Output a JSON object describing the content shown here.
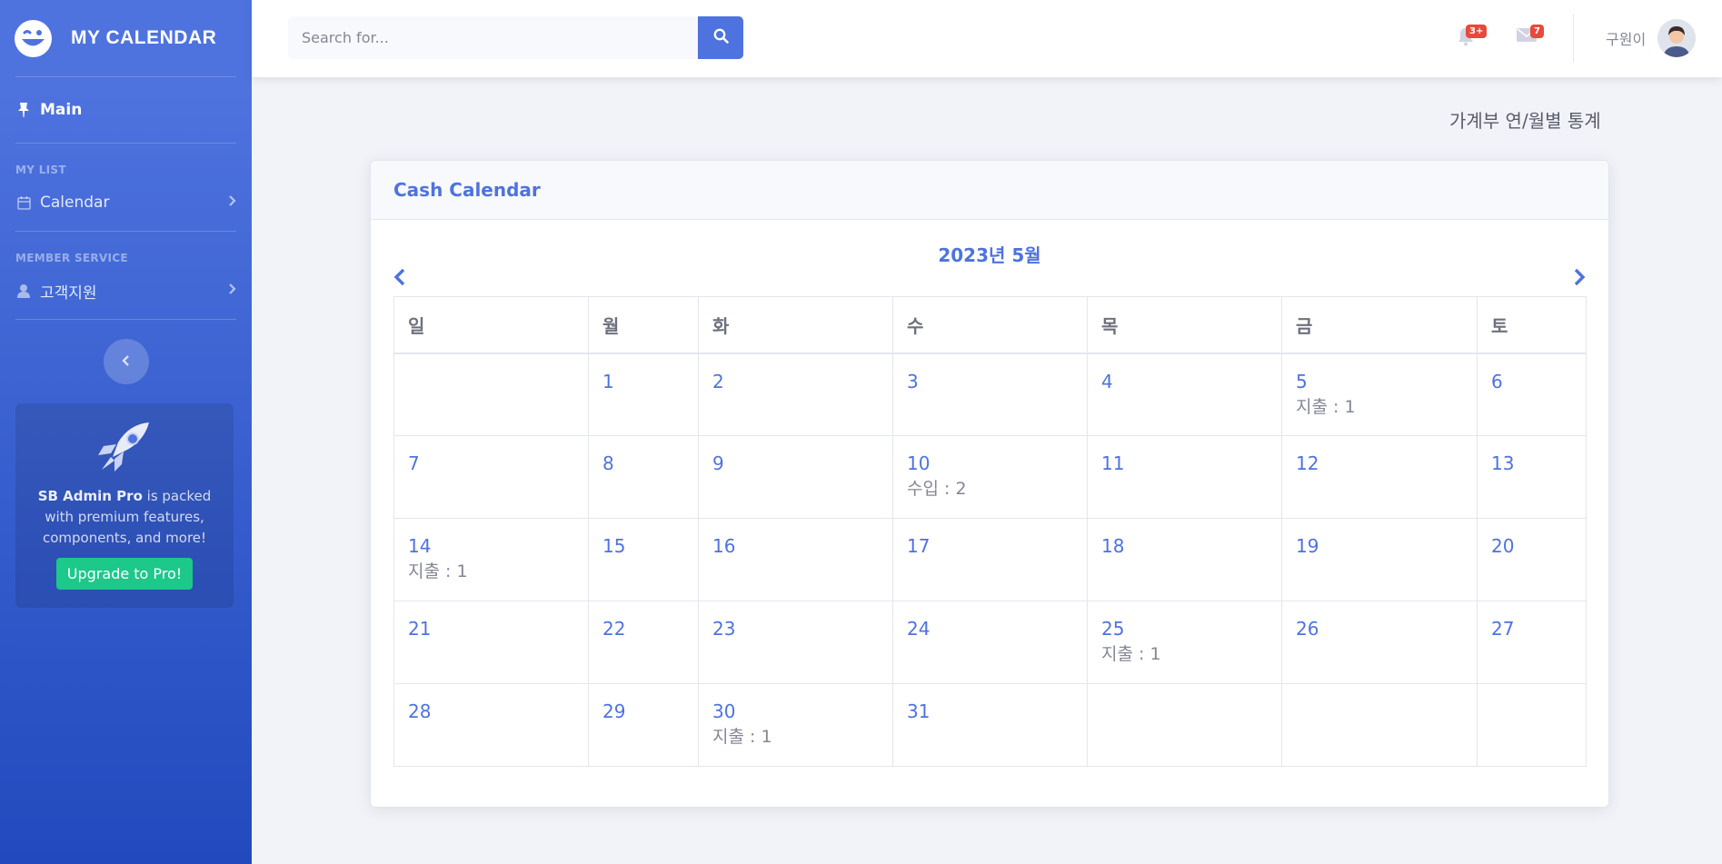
{
  "sidebar": {
    "brand": "MY CALENDAR",
    "main": "Main",
    "heading_list": "MY LIST",
    "calendar": "Calendar",
    "heading_member": "MEMBER SERVICE",
    "support": "고객지원",
    "promo": {
      "brand": "SB Admin Pro",
      "text": " is packed with premium features, components, and more!",
      "button": "Upgrade to Pro!"
    }
  },
  "topbar": {
    "search_placeholder": "Search for...",
    "alerts_badge": "3+",
    "messages_badge": "7",
    "username": "구원이"
  },
  "content": {
    "stats_link": "가계부 연/월별 통계",
    "card_title": "Cash Calendar",
    "month_title": "2023년 5월",
    "weekdays": [
      "일",
      "월",
      "화",
      "수",
      "목",
      "금",
      "토"
    ],
    "weeks": [
      [
        {
          "day": "",
          "note": ""
        },
        {
          "day": "1",
          "note": ""
        },
        {
          "day": "2",
          "note": ""
        },
        {
          "day": "3",
          "note": ""
        },
        {
          "day": "4",
          "note": ""
        },
        {
          "day": "5",
          "note": "지출 : 1"
        },
        {
          "day": "6",
          "note": ""
        }
      ],
      [
        {
          "day": "7",
          "note": ""
        },
        {
          "day": "8",
          "note": ""
        },
        {
          "day": "9",
          "note": ""
        },
        {
          "day": "10",
          "note": "수입 : 2"
        },
        {
          "day": "11",
          "note": ""
        },
        {
          "day": "12",
          "note": ""
        },
        {
          "day": "13",
          "note": ""
        }
      ],
      [
        {
          "day": "14",
          "note": "지출 : 1"
        },
        {
          "day": "15",
          "note": ""
        },
        {
          "day": "16",
          "note": ""
        },
        {
          "day": "17",
          "note": ""
        },
        {
          "day": "18",
          "note": ""
        },
        {
          "day": "19",
          "note": ""
        },
        {
          "day": "20",
          "note": ""
        }
      ],
      [
        {
          "day": "21",
          "note": ""
        },
        {
          "day": "22",
          "note": ""
        },
        {
          "day": "23",
          "note": ""
        },
        {
          "day": "24",
          "note": ""
        },
        {
          "day": "25",
          "note": "지출 : 1"
        },
        {
          "day": "26",
          "note": ""
        },
        {
          "day": "27",
          "note": ""
        }
      ],
      [
        {
          "day": "28",
          "note": ""
        },
        {
          "day": "29",
          "note": ""
        },
        {
          "day": "30",
          "note": "지출 : 1"
        },
        {
          "day": "31",
          "note": ""
        },
        {
          "day": "",
          "note": ""
        },
        {
          "day": "",
          "note": ""
        },
        {
          "day": "",
          "note": ""
        }
      ]
    ]
  },
  "colors": {
    "primary": "#4e73df",
    "success": "#1cc88a",
    "danger": "#e74a3b",
    "text_muted": "#858796"
  },
  "icons": {
    "brand": "laugh-wink-icon",
    "main": "thumbtack-icon",
    "calendar": "calendar-icon",
    "support": "user-icon",
    "search": "search-icon",
    "alerts": "bell-icon",
    "messages": "envelope-icon",
    "promo": "rocket-icon"
  }
}
